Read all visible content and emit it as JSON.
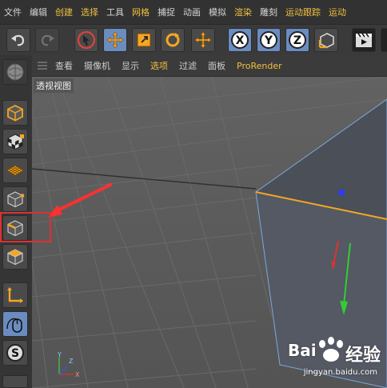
{
  "menu": {
    "items": [
      "文件",
      "编辑",
      "创建",
      "选择",
      "工具",
      "网格",
      "捕捉",
      "动画",
      "模拟",
      "渲染",
      "雕刻",
      "运动跟踪",
      "运动"
    ]
  },
  "viewport_menu": {
    "items": [
      "查看",
      "摄像机",
      "显示",
      "选项",
      "过滤",
      "面板",
      "ProRender"
    ]
  },
  "viewport": {
    "label": "透视视图",
    "axis_labels": {
      "y": "Y",
      "z": "Z",
      "x": "X"
    }
  },
  "toolbar": {
    "axis_x": "X",
    "axis_y": "Y",
    "axis_z": "Z"
  },
  "left_palette": {
    "tool_s": "S"
  },
  "watermark": {
    "brand_left": "Bai",
    "brand_right": "经验",
    "url": "jingyan.baidu.com"
  },
  "colors": {
    "accent": "#f0c040",
    "selected": "#6a8cc0",
    "highlight_box": "#e03030",
    "edge_highlight": "#f5a623"
  }
}
